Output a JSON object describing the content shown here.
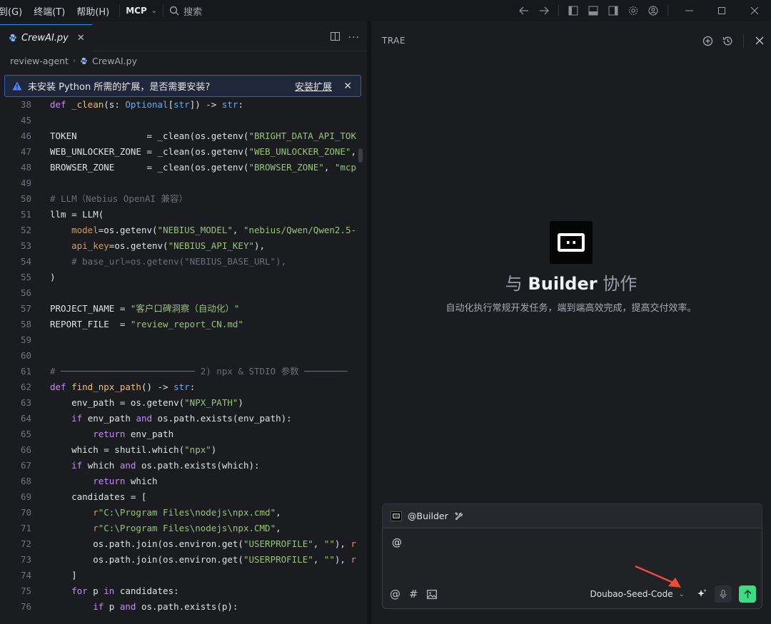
{
  "titlebar": {
    "menus": [
      "到(G)",
      "终端(T)",
      "帮助(H)"
    ],
    "mcp_label": "MCP",
    "search_placeholder": "搜索"
  },
  "editor": {
    "tab_label": "CrewAI.py",
    "breadcrumb": [
      "review-agent",
      "CrewAI.py"
    ],
    "banner": {
      "message": "未安装 Python 所需的扩展，是否需要安装?",
      "action": "安装扩展"
    },
    "code_lines": [
      {
        "n": "38",
        "html": "<span class='kw'>def</span> <span class='fn'>_clean</span>(s: <span class='ty'>Optional</span>[<span class='ty'>str</span>]) -> <span class='ty'>str</span>:"
      },
      {
        "n": "45",
        "html": ""
      },
      {
        "n": "46",
        "html": "TOKEN             = _clean(os.getenv(<span class='str'>\"BRIGHT_DATA_API_TOK</span>"
      },
      {
        "n": "47",
        "html": "WEB_UNLOCKER_ZONE = _clean(os.getenv(<span class='str'>\"WEB_UNLOCKER_ZONE\"</span>,"
      },
      {
        "n": "48",
        "html": "BROWSER_ZONE      = _clean(os.getenv(<span class='str'>\"BROWSER_ZONE\"</span>, <span class='str'>\"mcp</span>"
      },
      {
        "n": "49",
        "html": ""
      },
      {
        "n": "50",
        "html": "<span class='cm'># LLM（Nebius OpenAI 兼容）</span>"
      },
      {
        "n": "51",
        "html": "llm = LLM("
      },
      {
        "n": "52",
        "html": "    <span class='pm'>model</span>=os.getenv(<span class='str'>\"NEBIUS_MODEL\"</span>, <span class='str'>\"nebius/Qwen/Qwen2.5-</span>"
      },
      {
        "n": "53",
        "html": "    <span class='pm'>api_key</span>=os.getenv(<span class='str'>\"NEBIUS_API_KEY\"</span>),"
      },
      {
        "n": "54",
        "html": "    <span class='cm'># base_url=os.getenv(\"NEBIUS_BASE_URL\"),</span>"
      },
      {
        "n": "55",
        "html": ")"
      },
      {
        "n": "56",
        "html": ""
      },
      {
        "n": "57",
        "html": "PROJECT_NAME = <span class='str'>\"客户口碑洞察（自动化）\"</span>"
      },
      {
        "n": "58",
        "html": "REPORT_FILE  = <span class='str'>\"review_report_CN.md\"</span>"
      },
      {
        "n": "59",
        "html": ""
      },
      {
        "n": "60",
        "html": ""
      },
      {
        "n": "61",
        "html": "<span class='cm'># ───────────────────────── 2) npx &amp; STDIO 参数 ────────</span>"
      },
      {
        "n": "62",
        "html": "<span class='kw'>def</span> <span class='fn'>find_npx_path</span>() -> <span class='ty'>str</span>:"
      },
      {
        "n": "63",
        "html": "    env_path = os.getenv(<span class='str'>\"NPX_PATH\"</span>)"
      },
      {
        "n": "64",
        "html": "    <span class='kw'>if</span> env_path <span class='kw'>and</span> os.path.exists(env_path):"
      },
      {
        "n": "65",
        "html": "        <span class='kw'>return</span> env_path"
      },
      {
        "n": "66",
        "html": "    which = shutil.which(<span class='str'>\"npx\"</span>)"
      },
      {
        "n": "67",
        "html": "    <span class='kw'>if</span> which <span class='kw'>and</span> os.path.exists(which):"
      },
      {
        "n": "68",
        "html": "        <span class='kw'>return</span> which"
      },
      {
        "n": "69",
        "html": "    candidates = ["
      },
      {
        "n": "70",
        "html": "        <span class='pm'>r</span><span class='str'>\"C:\\Program Files\\nodejs\\npx.cmd\"</span>,"
      },
      {
        "n": "71",
        "html": "        <span class='pm'>r</span><span class='str'>\"C:\\Program Files\\nodejs\\npx.CMD\"</span>,"
      },
      {
        "n": "72",
        "html": "        os.path.join(os.environ.get(<span class='str'>\"USERPROFILE\"</span>, <span class='str'>\"\"</span>), <span class='pm'>r</span>"
      },
      {
        "n": "73",
        "html": "        os.path.join(os.environ.get(<span class='str'>\"USERPROFILE\"</span>, <span class='str'>\"\"</span>), <span class='pm'>r</span>"
      },
      {
        "n": "74",
        "html": "    ]"
      },
      {
        "n": "75",
        "html": "    <span class='kw'>for</span> p <span class='kw'>in</span> candidates:"
      },
      {
        "n": "76",
        "html": "        <span class='kw'>if</span> p <span class='kw'>and</span> os.path.exists(p):"
      }
    ]
  },
  "panel": {
    "title": "TRAE",
    "hero_prefix": "与",
    "hero_name": "Builder",
    "hero_suffix": "协作",
    "hero_subtitle": "自动化执行常规开发任务，端到端高效完成，提高交付效率。",
    "context_label": "@Builder",
    "input_value": "@",
    "model_name": "Doubao-Seed-Code"
  }
}
